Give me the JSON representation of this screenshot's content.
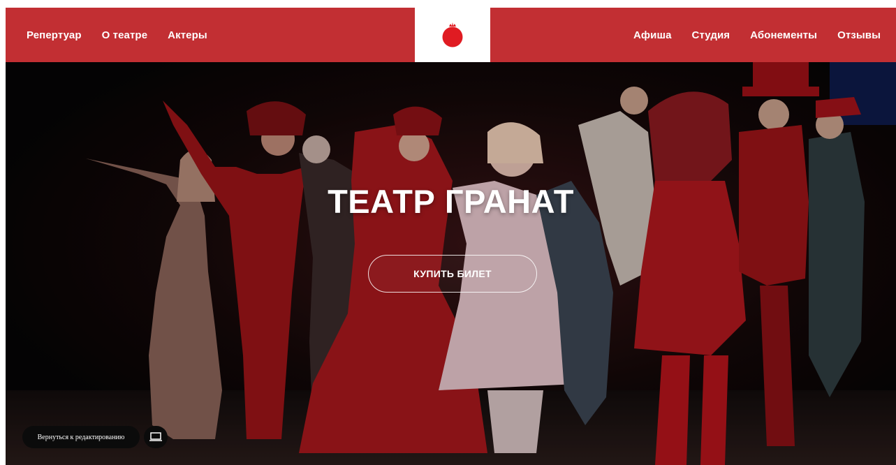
{
  "header": {
    "nav_left": [
      "Репертуар",
      "О театре",
      "Актеры"
    ],
    "nav_right": [
      "Афиша",
      "Студия",
      "Абонементы",
      "Отзывы"
    ],
    "logo_icon": "pomegranate-icon"
  },
  "hero": {
    "title": "ТЕАТР ГРАНАТ",
    "buy_label": "КУПИТЬ БИЛЕТ"
  },
  "editor": {
    "back_label": "Вернуться к редактированию",
    "device_icon": "laptop-icon"
  },
  "colors": {
    "brand_red": "#c22f33",
    "white": "#ffffff",
    "hero_dark": "#070607"
  }
}
